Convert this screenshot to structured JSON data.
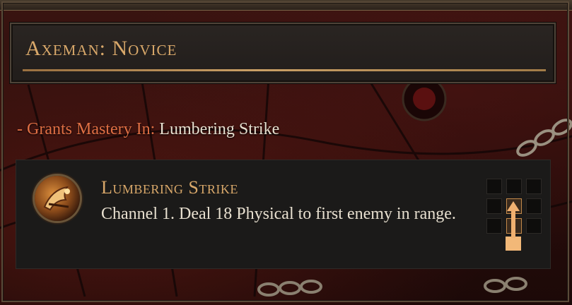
{
  "header": {
    "title": "Axeman: Novice"
  },
  "grant": {
    "prefix": "- Grants Mastery In:",
    "skill": "Lumbering Strike"
  },
  "skill": {
    "name": "Lumbering Strike",
    "description": "Channel 1. Deal 18 Physical to first enemy in range.",
    "icon": "axe-strike-icon",
    "pattern_grid": {
      "rows": 3,
      "cols": 3,
      "highlighted_column": 1,
      "direction": "up"
    }
  },
  "colors": {
    "title_gold": "#d9a86a",
    "grant_prefix": "#e06f44",
    "text_light": "#e8e0d0",
    "arrow_orange": "#f0b070"
  }
}
